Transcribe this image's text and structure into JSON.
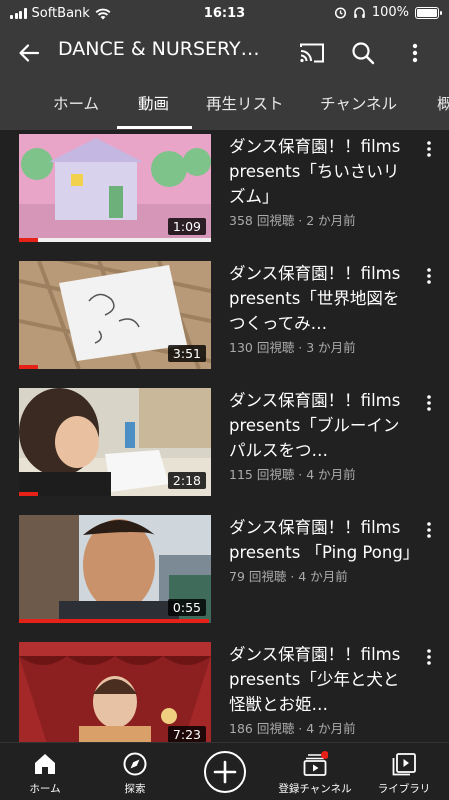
{
  "status_bar": {
    "carrier": "SoftBank",
    "time": "16:13",
    "battery": "100%"
  },
  "app_bar": {
    "title": "DANCE & NURSERY…",
    "icons": [
      "back-arrow-icon",
      "cast-icon",
      "search-icon",
      "more-vert-icon"
    ]
  },
  "tabs": [
    {
      "label": "ホーム",
      "active": false
    },
    {
      "label": "動画",
      "active": true
    },
    {
      "label": "再生リスト",
      "active": false
    },
    {
      "label": "チャンネル",
      "active": false
    },
    {
      "label": "概",
      "active": false
    }
  ],
  "videos": [
    {
      "title": "ダンス保育園！！films presents「ちいさいリズム」",
      "info": "358 回視聴 · 2 か月前",
      "duration": "1:09",
      "watched": 0.1
    },
    {
      "title": "ダンス保育園！！films presents「世界地図をつくってみ…",
      "info": "130 回視聴 · 3 か月前",
      "duration": "3:51",
      "watched": 0.1
    },
    {
      "title": "ダンス保育園！！films presents「ブルーインパルスをつ…",
      "info": "115 回視聴 · 4 か月前",
      "duration": "2:18",
      "watched": 0.1
    },
    {
      "title": "ダンス保育園！！films presents 「Ping Pong」",
      "info": "79 回視聴 · 4 か月前",
      "duration": "0:55",
      "watched": 0.99
    },
    {
      "title": "ダンス保育園！！films presents「少年と犬と怪獣とお姫…",
      "info": "186 回視聴 · 4 か月前",
      "duration": "7:23",
      "watched": 0.1
    }
  ],
  "bottom_nav": [
    {
      "label": "ホーム",
      "icon": "home-icon"
    },
    {
      "label": "探索",
      "icon": "explore-icon"
    },
    {
      "label": "",
      "icon": "create-plus-icon"
    },
    {
      "label": "登録チャンネル",
      "icon": "subscriptions-icon"
    },
    {
      "label": "ライブラリ",
      "icon": "library-icon"
    }
  ],
  "colors": {
    "background": "#212121",
    "header": "#3a3a3a",
    "accent_red": "#e62117"
  }
}
